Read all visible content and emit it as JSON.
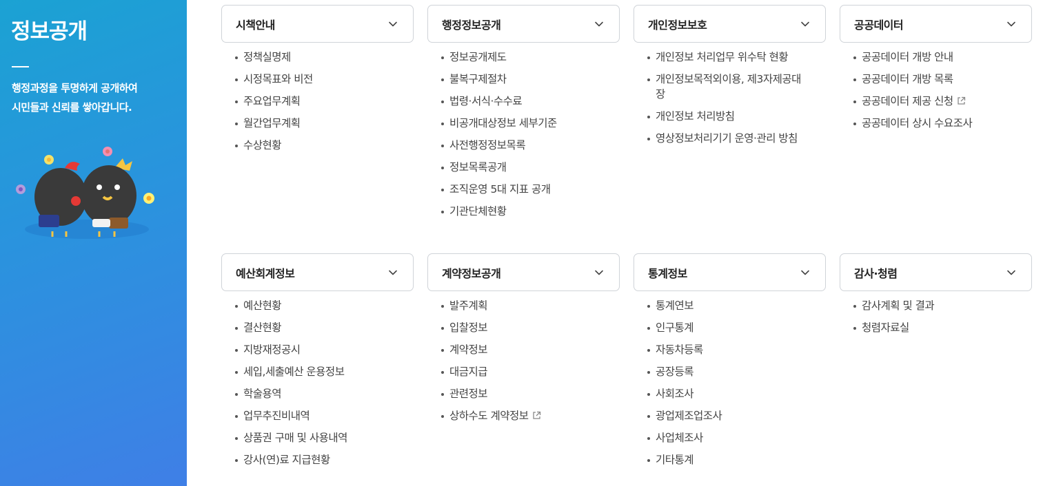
{
  "sidebar": {
    "title": "정보공개",
    "desc_line1": "행정과정을 투명하게 공개하여",
    "desc_line2": "시민들과 신뢰를 쌓아갑니다."
  },
  "categories": [
    {
      "title": "시책안내",
      "items": [
        {
          "label": "정책실명제"
        },
        {
          "label": "시정목표와 비전"
        },
        {
          "label": "주요업무계획"
        },
        {
          "label": "월간업무계획"
        },
        {
          "label": "수상현황"
        }
      ]
    },
    {
      "title": "행정정보공개",
      "items": [
        {
          "label": "정보공개제도"
        },
        {
          "label": "불복구제절차"
        },
        {
          "label": "법령·서식·수수료"
        },
        {
          "label": "비공개대상정보 세부기준"
        },
        {
          "label": "사전행정정보목록"
        },
        {
          "label": "정보목록공개"
        },
        {
          "label": "조직운영 5대 지표 공개"
        },
        {
          "label": "기관단체현황"
        }
      ]
    },
    {
      "title": "개인정보보호",
      "items": [
        {
          "label": "개인정보 처리업무 위수탁 현황"
        },
        {
          "label": "개인정보목적외이용, 제3자제공대장"
        },
        {
          "label": "개인정보 처리방침"
        },
        {
          "label": "영상정보처리기기 운영·관리 방침"
        }
      ]
    },
    {
      "title": "공공데이터",
      "items": [
        {
          "label": "공공데이터 개방 안내"
        },
        {
          "label": "공공데이터 개방 목록"
        },
        {
          "label": "공공데이터 제공 신청",
          "external": true
        },
        {
          "label": "공공데이터 상시 수요조사"
        }
      ]
    },
    {
      "title": "예산회계정보",
      "items": [
        {
          "label": "예산현황"
        },
        {
          "label": "결산현황"
        },
        {
          "label": "지방재정공시"
        },
        {
          "label": "세입,세출예산 운용정보"
        },
        {
          "label": "학술용역"
        },
        {
          "label": "업무추진비내역"
        },
        {
          "label": "상품권 구매 및 사용내역"
        },
        {
          "label": "강사(연)료 지급현황"
        }
      ]
    },
    {
      "title": "계약정보공개",
      "items": [
        {
          "label": "발주계획"
        },
        {
          "label": "입찰정보"
        },
        {
          "label": "계약정보"
        },
        {
          "label": "대금지급"
        },
        {
          "label": "관련정보"
        },
        {
          "label": "상하수도 계약정보",
          "external": true
        }
      ]
    },
    {
      "title": "통계정보",
      "items": [
        {
          "label": "통계연보"
        },
        {
          "label": "인구통계"
        },
        {
          "label": "자동차등록"
        },
        {
          "label": "공장등록"
        },
        {
          "label": "사회조사"
        },
        {
          "label": "광업제조업조사"
        },
        {
          "label": "사업체조사"
        },
        {
          "label": "기타통계"
        }
      ]
    },
    {
      "title": "감사·청렴",
      "items": [
        {
          "label": "감사계획 및 결과"
        },
        {
          "label": "청렴자료실"
        }
      ]
    }
  ],
  "icons": {
    "chevron": "chevron-down-icon",
    "external": "external-link-icon"
  }
}
